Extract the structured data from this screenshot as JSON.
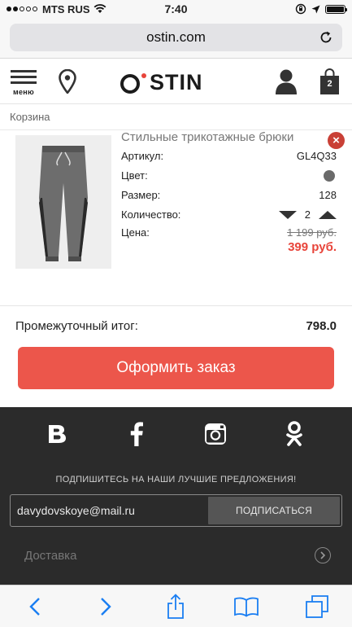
{
  "status": {
    "carrier": "MTS RUS",
    "time": "7:40"
  },
  "browser": {
    "url": "ostin.com"
  },
  "header": {
    "menu_label": "меню",
    "logo": "O'STIN",
    "cart_count": "2"
  },
  "breadcrumb": "Корзина",
  "product": {
    "name": "Стильные трикотажные брюки",
    "remove_label": "×",
    "article_label": "Артикул:",
    "article": "GL4Q33",
    "color_label": "Цвет:",
    "color_value": "#6a6a6a",
    "size_label": "Размер:",
    "size": "128",
    "qty_label": "Количество:",
    "qty": "2",
    "price_label": "Цена:",
    "old_price": "1 199 руб.",
    "new_price": "399 руб."
  },
  "summary": {
    "subtotal_label": "Промежуточный итог:",
    "subtotal": "798.0"
  },
  "checkout": {
    "label": "Оформить заказ"
  },
  "footer": {
    "socials": [
      "vk-icon",
      "facebook-icon",
      "instagram-icon",
      "odnoklassniki-icon"
    ],
    "subscribe_title": "ПОДПИШИТЕСЬ НА НАШИ ЛУЧШИЕ ПРЕДЛОЖЕНИЯ!",
    "email": "davydovskoye@mail.ru",
    "subscribe_button": "ПОДПИСАТЬСЯ",
    "delivery": "Доставка"
  },
  "colors": {
    "accent": "#ec564b",
    "footer_bg": "#2b2b2b",
    "ios_blue": "#1a7ef2"
  }
}
